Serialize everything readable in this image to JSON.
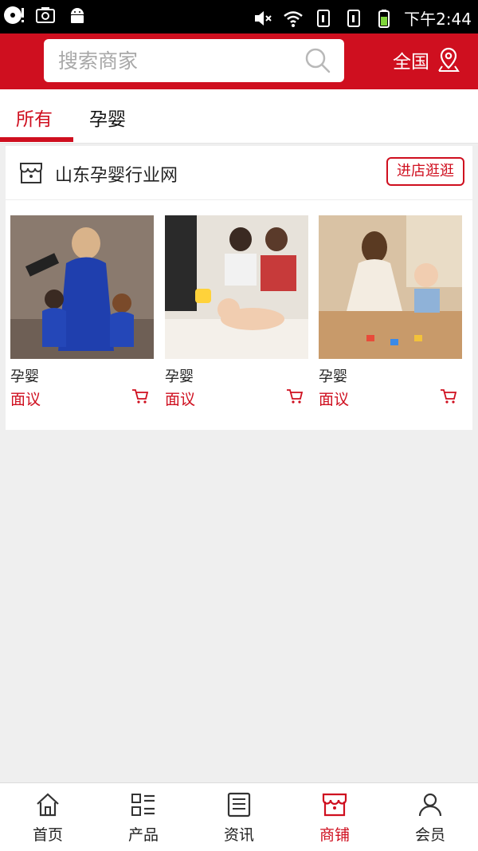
{
  "status_bar": {
    "time": "下午2:44"
  },
  "header": {
    "search_placeholder": "搜索商家",
    "region_label": "全国"
  },
  "tabs": [
    {
      "label": "所有",
      "active": true
    },
    {
      "label": "孕婴",
      "active": false
    }
  ],
  "shop": {
    "name": "山东孕婴行业网",
    "enter_label": "进店逛逛"
  },
  "products": [
    {
      "name": "孕婴",
      "price": "面议"
    },
    {
      "name": "孕婴",
      "price": "面议"
    },
    {
      "name": "孕婴",
      "price": "面议"
    }
  ],
  "bottom_nav": [
    {
      "label": "首页",
      "icon": "home-icon"
    },
    {
      "label": "产品",
      "icon": "list-icon"
    },
    {
      "label": "资讯",
      "icon": "news-icon"
    },
    {
      "label": "商铺",
      "icon": "store-icon",
      "active": true
    },
    {
      "label": "会员",
      "icon": "user-icon"
    }
  ],
  "colors": {
    "accent": "#cf0f1f",
    "background": "#efefef"
  }
}
